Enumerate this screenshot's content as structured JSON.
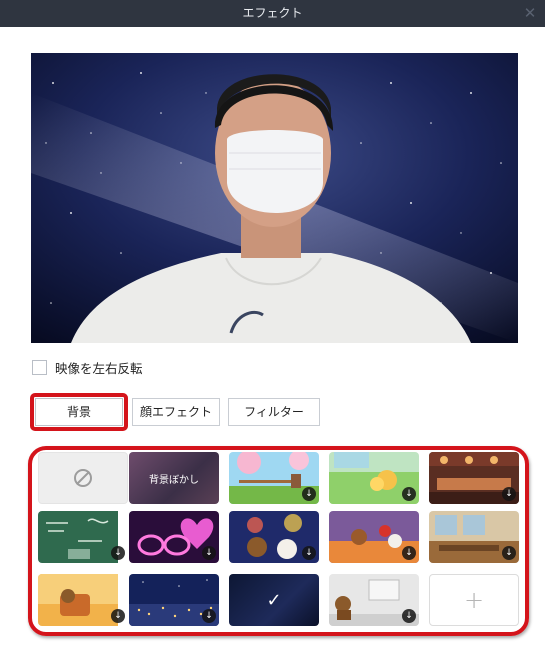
{
  "window": {
    "title": "エフェクト",
    "close_glyph": "✕"
  },
  "preview": {
    "description_icon": "camera-preview"
  },
  "mirror": {
    "label": "映像を左右反転",
    "checked": false
  },
  "tabs": [
    {
      "label": "背景",
      "active": true
    },
    {
      "label": "顔エフェクト",
      "active": false
    },
    {
      "label": "フィルター",
      "active": false
    }
  ],
  "backgrounds": {
    "blur_label": "背景ぼかし",
    "selected_index": 12,
    "download_glyph": "↓",
    "selected_glyph": "✓",
    "add_glyph": "+",
    "items": [
      {
        "kind": "none",
        "icon": "none-icon"
      },
      {
        "kind": "blur",
        "icon": "blur-icon"
      },
      {
        "kind": "image",
        "icon": "download-icon"
      },
      {
        "kind": "image",
        "icon": "download-icon"
      },
      {
        "kind": "image",
        "icon": "download-icon"
      },
      {
        "kind": "image",
        "icon": "download-icon"
      },
      {
        "kind": "image",
        "icon": "download-icon"
      },
      {
        "kind": "image",
        "icon": "download-icon"
      },
      {
        "kind": "image",
        "icon": "download-icon"
      },
      {
        "kind": "image",
        "icon": "download-icon"
      },
      {
        "kind": "image",
        "icon": "download-icon"
      },
      {
        "kind": "image",
        "icon": "download-icon"
      },
      {
        "kind": "selected",
        "icon": "check-icon"
      },
      {
        "kind": "image",
        "icon": "download-icon"
      },
      {
        "kind": "add",
        "icon": "plus-icon"
      }
    ]
  },
  "colors": {
    "highlight": "#d4141b",
    "titlebar": "#2f3540"
  }
}
